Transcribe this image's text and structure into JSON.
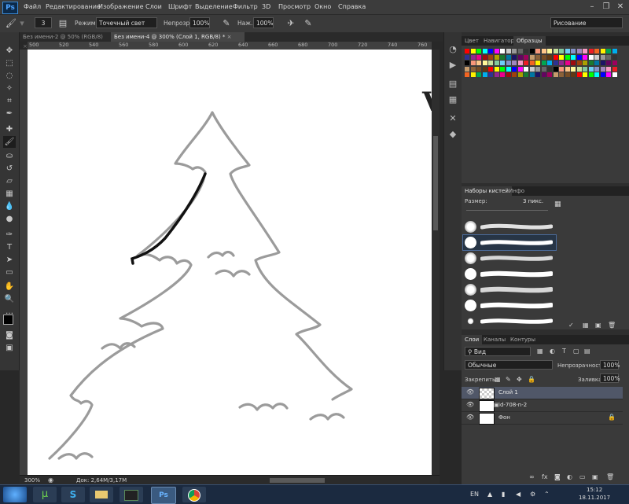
{
  "app": {
    "logo": "Ps"
  },
  "menu": [
    "Файл",
    "Редактирование",
    "Изображение",
    "Слои",
    "Шрифт",
    "Выделение",
    "Фильтр",
    "3D",
    "Просмотр",
    "Окно",
    "Справка"
  ],
  "window_buttons": [
    "–",
    "❐",
    "✕"
  ],
  "options": {
    "brush_size": "3",
    "mode_label": "Режим:",
    "mode_value": "Точечный свет",
    "opacity_label": "Непрозр.:",
    "opacity_value": "100%",
    "pressure_label": "Наж.:",
    "pressure_value": "100%",
    "workspace": "Рисование"
  },
  "doc_tabs": [
    {
      "label": "Без имени-2 @ 50% (RGB/8)",
      "active": false
    },
    {
      "label": "Без имени-4 @ 300% (Слой 1, RGB/8) *",
      "active": true
    }
  ],
  "ruler_numbers": [
    "500",
    "520",
    "540",
    "560",
    "580",
    "600",
    "620",
    "640",
    "660",
    "680",
    "700",
    "720",
    "740",
    "760"
  ],
  "status": {
    "zoom": "300%",
    "doc": "Док: 2,64M/3,17M"
  },
  "panels": {
    "color_tabs": [
      "Цвет",
      "Навигатор",
      "Образцы"
    ],
    "brush_tabs": [
      "Наборы кистей",
      "Инфо"
    ],
    "brush_size_label": "Размер:",
    "brush_size_value": "3 пикс.",
    "layers_tabs": [
      "Слои",
      "Каналы",
      "Контуры"
    ],
    "filter_label": "Вид",
    "blend_mode": "Обычные",
    "opacity_label": "Непрозрачность:",
    "opacity_value": "100%",
    "lock_label": "Закрепить:",
    "fill_label": "Заливка:",
    "fill_value": "100%",
    "layers": [
      {
        "name": "Слой 1",
        "selected": true
      },
      {
        "name": "id-708-n-2",
        "selected": false
      },
      {
        "name": "Фон",
        "selected": false
      }
    ]
  },
  "colors": {
    "accent_selected": "#505768",
    "canvas": "#ffffff",
    "taskbar": "#1b2a40",
    "swatches": [
      "#ff0000",
      "#ffff00",
      "#00ff00",
      "#00ffff",
      "#0000ff",
      "#ff00ff",
      "#ffffff",
      "#cccccc",
      "#999999",
      "#666666",
      "#333333",
      "#000000",
      "#f7977a",
      "#fdc68a",
      "#fff79a",
      "#c4df9b",
      "#82ca9d",
      "#6ecff6",
      "#8493ca",
      "#a187be",
      "#f49ac2",
      "#ed1c24",
      "#f26522",
      "#fff200",
      "#00a651",
      "#00aeef",
      "#2e3192",
      "#92278f",
      "#ec008c",
      "#9e0b0f",
      "#a0410d",
      "#aba000",
      "#197b30",
      "#0076a3",
      "#1b1464",
      "#630460",
      "#9e005d",
      "#c69c6d",
      "#8c6239",
      "#754c24",
      "#603913"
    ]
  },
  "taskbar": {
    "lang": "EN",
    "time": "15:12",
    "date": "18.11.2017",
    "apps": [
      "windows-start",
      "utorrent",
      "skype",
      "explorer",
      "terminal",
      "photoshop",
      "chrome"
    ]
  }
}
